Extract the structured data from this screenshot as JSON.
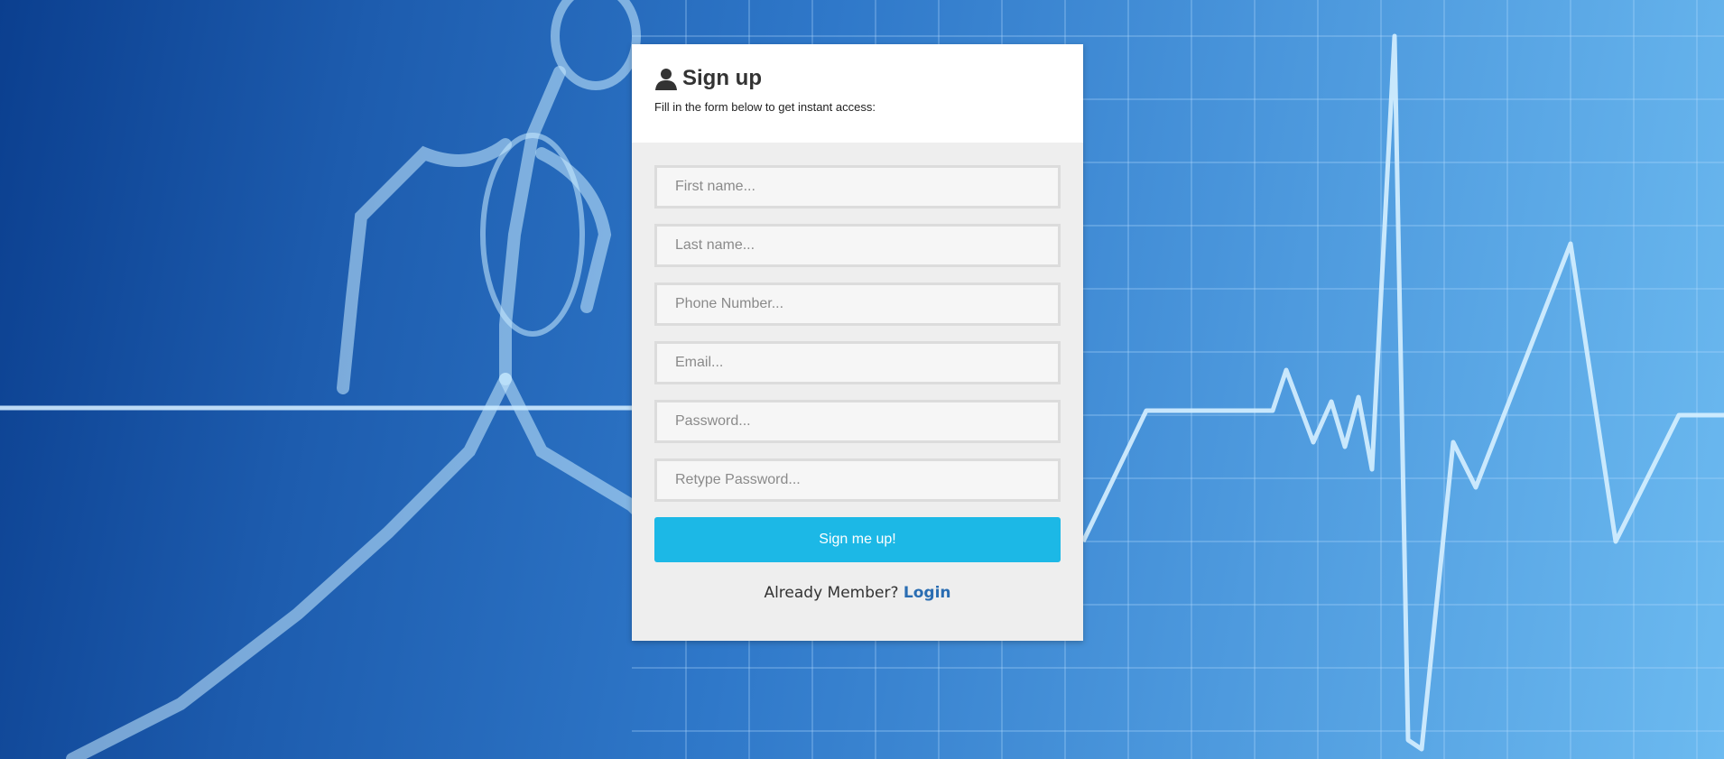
{
  "header": {
    "title": "Sign up",
    "subtitle": "Fill in the form below to get instant access:"
  },
  "form": {
    "fields": [
      {
        "placeholder": "First name...",
        "value": ""
      },
      {
        "placeholder": "Last name...",
        "value": ""
      },
      {
        "placeholder": "Phone Number...",
        "value": ""
      },
      {
        "placeholder": "Email...",
        "value": ""
      },
      {
        "placeholder": "Password...",
        "value": ""
      },
      {
        "placeholder": "Retype Password...",
        "value": ""
      }
    ],
    "submit_label": "Sign me up!"
  },
  "footer": {
    "prompt": "Already Member?",
    "login_link": "Login"
  },
  "icons": {
    "title_icon": "user-icon"
  },
  "colors": {
    "accent": "#1cb8e6",
    "link": "#2a6db2",
    "background_gradient_start": "#0b3f8f",
    "background_gradient_end": "#6cbaf0"
  }
}
